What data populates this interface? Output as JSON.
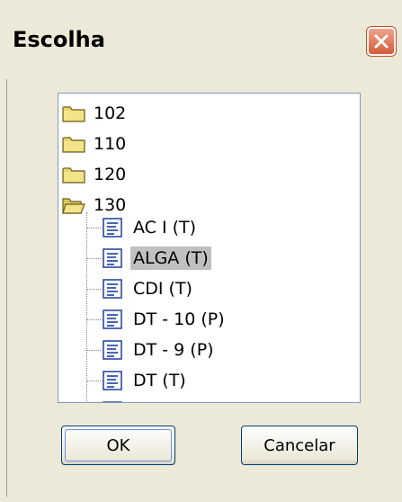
{
  "window": {
    "title": "Escolha"
  },
  "tree": {
    "folders": [
      {
        "label": "102",
        "expanded": false
      },
      {
        "label": "110",
        "expanded": false
      },
      {
        "label": "120",
        "expanded": false
      },
      {
        "label": "130",
        "expanded": true
      }
    ],
    "children": [
      {
        "label": "AC I (T)",
        "selected": false
      },
      {
        "label": "ALGA (T)",
        "selected": true
      },
      {
        "label": "CDI (T)",
        "selected": false
      },
      {
        "label": "DT - 10 (P)",
        "selected": false
      },
      {
        "label": "DT - 9 (P)",
        "selected": false
      },
      {
        "label": "DT (T)",
        "selected": false
      }
    ]
  },
  "buttons": {
    "ok_label": "OK",
    "cancel_label": "Cancelar"
  },
  "colors": {
    "selection": "#c0c0c0",
    "close_button": "#d55a37",
    "dialog_bg": "#ece9d8"
  }
}
